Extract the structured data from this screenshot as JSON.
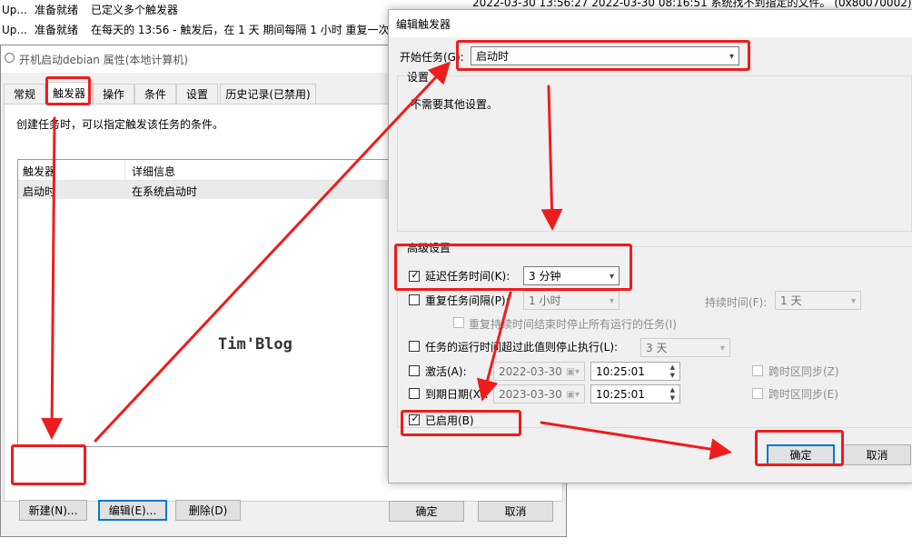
{
  "task_list": {
    "rows": [
      {
        "name": "Up...",
        "status": "准备就绪",
        "trigger": "已定义多个触发器",
        "tail": "2022-03-30 13:56:27    2022-03-30 08:16:51    系统找不到指定的文件。    (0x80070002)"
      },
      {
        "name": "Up...",
        "status": "准备就绪",
        "trigger": "在每天的 13:56 - 触发后，在 1 天 期间每隔 1 小时 重复一次。"
      }
    ]
  },
  "properties": {
    "title": "开机启动debian 属性(本地计算机)",
    "tabs": [
      "常规",
      "触发器",
      "操作",
      "条件",
      "设置",
      "历史记录(已禁用)"
    ],
    "description": "创建任务时，可以指定触发该任务的条件。",
    "table": {
      "headers": [
        "触发器",
        "详细信息"
      ],
      "rows": [
        {
          "trigger": "启动时",
          "details": "在系统启动时"
        }
      ]
    },
    "watermark": "Tim'Blog",
    "buttons": {
      "new": "新建(N)...",
      "edit": "编辑(E)...",
      "delete": "删除(D)"
    },
    "footer": {
      "ok": "确定",
      "cancel": "取消"
    }
  },
  "edit_trigger": {
    "title": "编辑触发器",
    "begin_task_label": "开始任务(G):",
    "begin_task_value": "启动时",
    "settings_group": "设置",
    "settings_note": "不需要其他设置。",
    "advanced_group": "高级设置",
    "delay": {
      "label": "延迟任务时间(K):",
      "value": "3 分钟",
      "checked": true
    },
    "repeat": {
      "label": "重复任务间隔(P):",
      "value": "1 小时",
      "checked": false
    },
    "duration": {
      "label": "持续时间(F):",
      "value": "1 天"
    },
    "stop_all": {
      "label": "重复持续时间结束时停止所有运行的任务(I)"
    },
    "stop_if_longer": {
      "label": "任务的运行时间超过此值则停止执行(L):",
      "value": "3 天",
      "checked": false
    },
    "activate": {
      "label": "激活(A):",
      "date": "2022-03-30",
      "time": "10:25:01",
      "sync_label": "跨时区同步(Z)"
    },
    "expire": {
      "label": "到期日期(X):",
      "date": "2023-03-30",
      "time": "10:25:01",
      "sync_label": "跨时区同步(E)"
    },
    "enabled": {
      "label": "已启用(B)",
      "checked": true
    },
    "buttons": {
      "ok": "确定",
      "cancel": "取消"
    }
  },
  "colors": {
    "annotation_red": "#ee1c1c",
    "focus_blue": "#0078d7"
  }
}
